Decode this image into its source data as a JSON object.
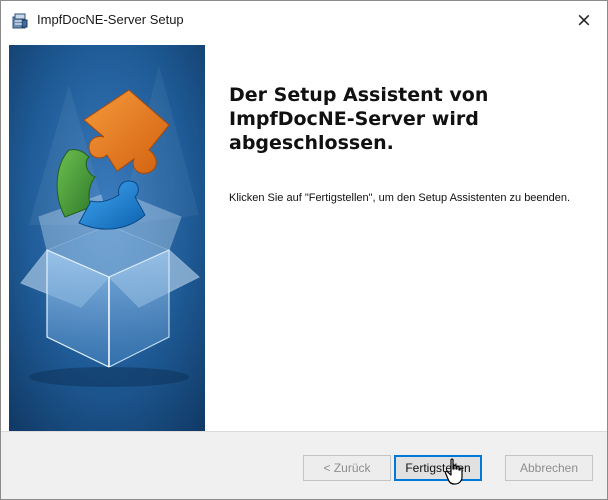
{
  "window": {
    "title": "ImpfDocNE-Server Setup",
    "close_label": "×"
  },
  "icons": {
    "app": "installer-icon",
    "close": "close-icon",
    "illustration": "puzzle-box-illustration",
    "cursor": "hand-pointer-icon"
  },
  "content": {
    "headline": "Der Setup Assistent von ImpfDocNE-Server wird abgeschlossen.",
    "body": "Klicken Sie auf \"Fertigstellen\", um den Setup Assistenten zu beenden."
  },
  "footer": {
    "back_label": "< Zurück",
    "finish_label": "Fertigstellen",
    "cancel_label": "Abbrechen"
  },
  "colors": {
    "side_panel": "#1f5c98",
    "puzzle_orange": "#e87320",
    "puzzle_green": "#4a9a3b",
    "puzzle_blue": "#1c84d8",
    "accent": "#0078d7"
  }
}
